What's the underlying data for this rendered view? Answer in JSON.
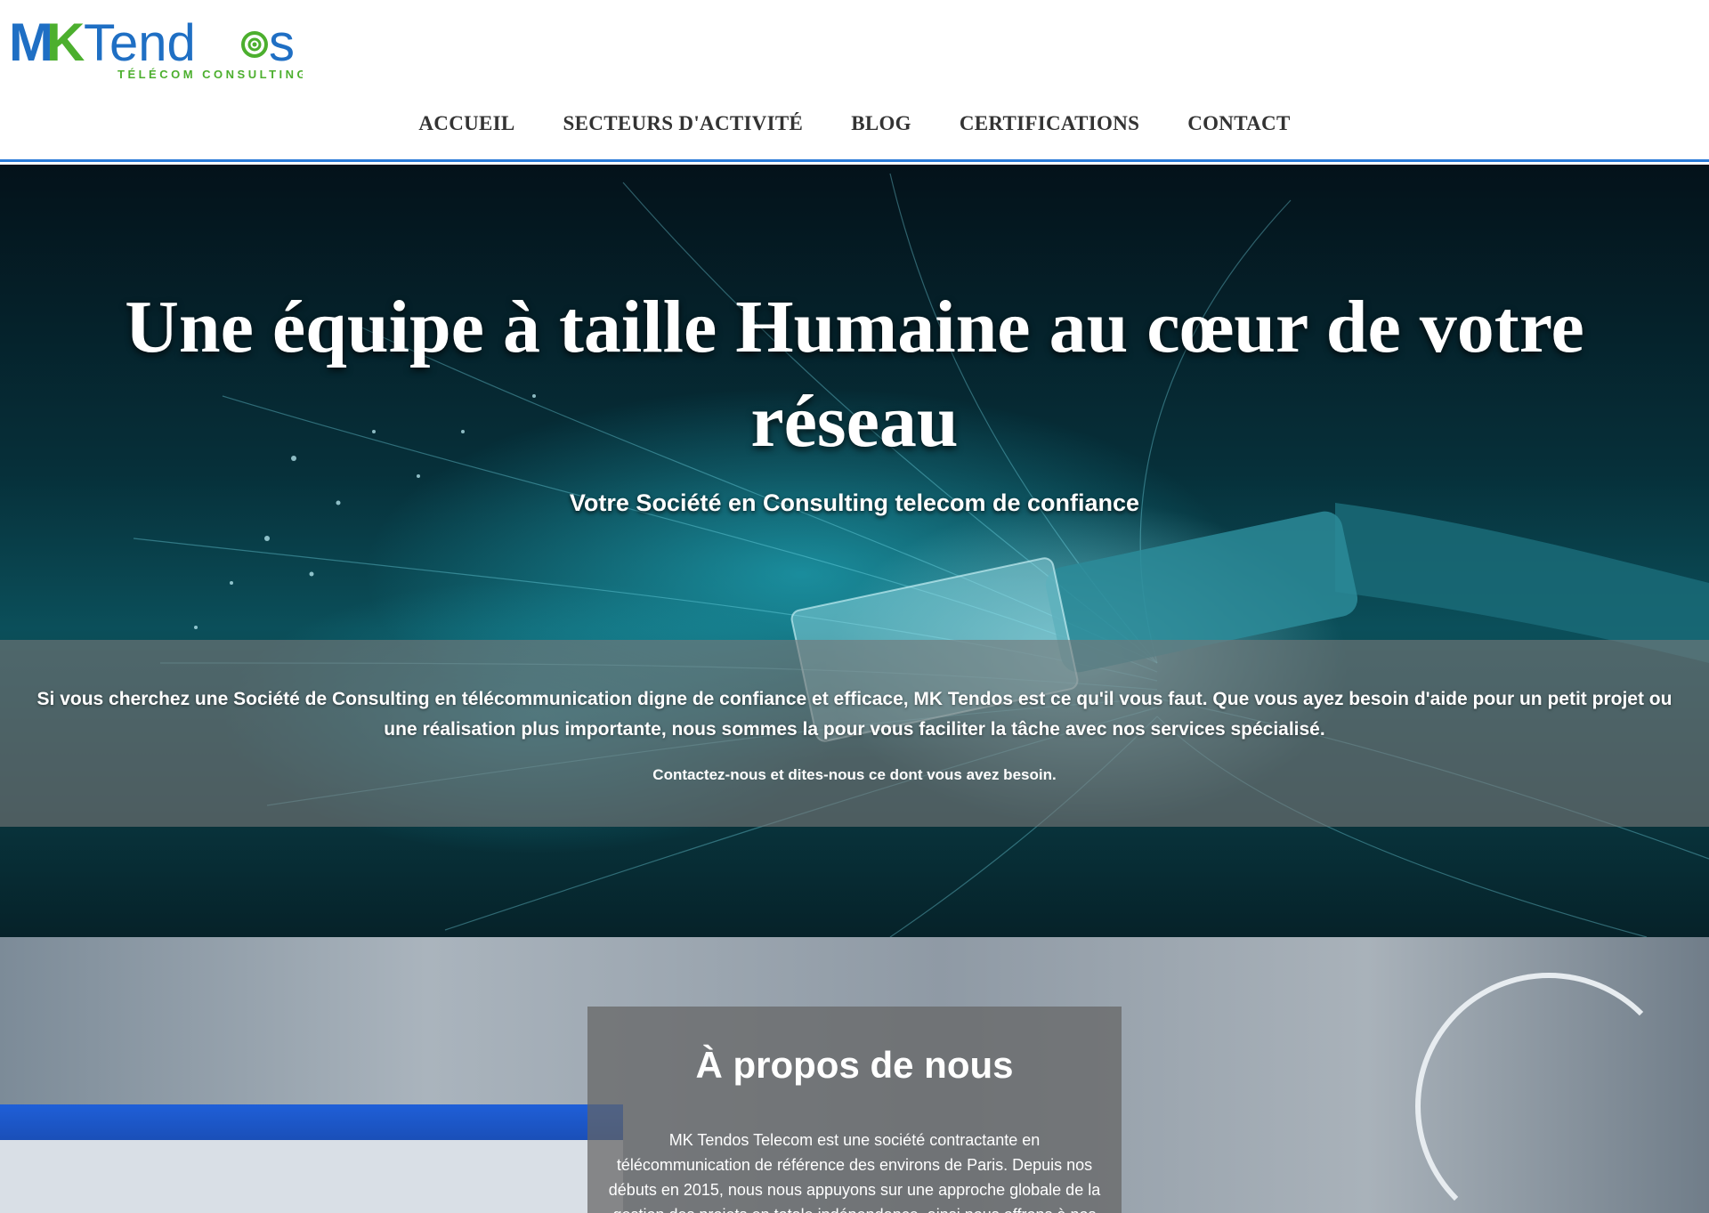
{
  "brand": {
    "logo_main": "MKTendos",
    "logo_tagline": "TÉLÉCOM CONSULTING"
  },
  "nav": {
    "items": [
      "ACCUEIL",
      "SECTEURS D'ACTIVITÉ",
      "BLOG",
      "CERTIFICATIONS",
      "CONTACT"
    ]
  },
  "hero": {
    "title": "Une équipe à taille Humaine au cœur de votre réseau",
    "subtitle": "Votre Société en Consulting telecom de confiance",
    "band_text": "Si vous cherchez une Société de Consulting en télécommunication digne de confiance et efficace, MK Tendos est ce qu'il vous faut. Que vous ayez besoin d'aide pour un petit projet ou une réalisation plus importante, nous sommes la pour vous faciliter la tâche avec nos services spécialisé.",
    "band_cta": "Contactez-nous et dites-nous ce dont vous avez besoin."
  },
  "about": {
    "title": "À propos de nous",
    "text": "MK Tendos Telecom est une société contractante en télécommunication de référence des environs de Paris. Depuis nos débuts en 2015, nous nous appuyons sur une approche globale de la gestion des projets en totale indépendance, ainsi nous offrons à nos"
  },
  "colors": {
    "logo_blue": "#1f6fc4",
    "logo_green": "#4caf2e",
    "nav_text": "#333333",
    "header_rule": "#2a7ad8"
  }
}
